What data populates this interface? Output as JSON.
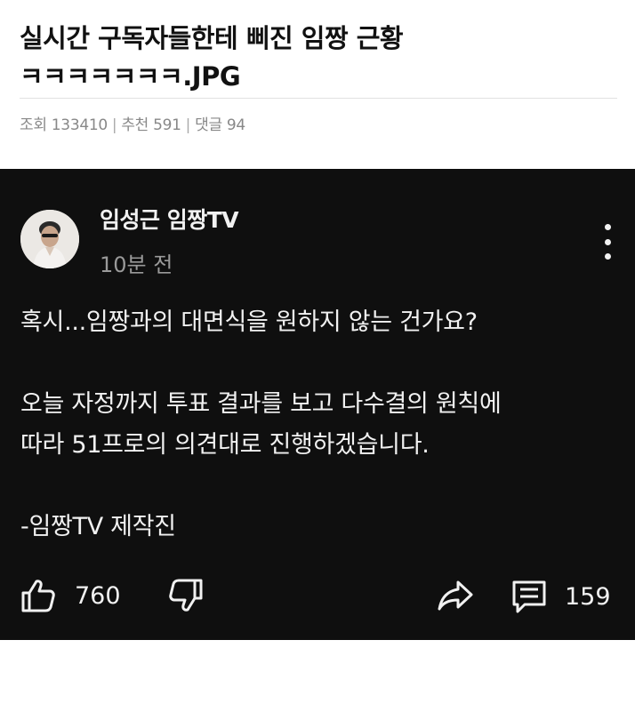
{
  "post": {
    "title_line1": "실시간 구독자들한테 삐진 임짱 근황",
    "title_line2": "ㅋㅋㅋㅋㅋㅋㅋ.JPG",
    "views_label": "조회 133410",
    "recommend_label": "추천 591",
    "comments_label": "댓글 94",
    "separator": "|"
  },
  "community_post": {
    "channel_name": "임성근 임짱TV",
    "time_ago": "10분 전",
    "body_line1": "혹시...임짱과의 대면식을 원하지 않는 건가요?",
    "body_line2": "오늘 자정까지 투표 결과를 보고 다수결의 원칙에",
    "body_line3": "따라 51프로의 의견대로 진행하겠습니다.",
    "body_line4": "-임짱TV 제작진",
    "likes": "760",
    "comments": "159"
  },
  "icons": {
    "like": "thumbs-up-icon",
    "dislike": "thumbs-down-icon",
    "share": "share-icon",
    "comment": "comment-icon",
    "more": "more-vertical-icon"
  },
  "colors": {
    "card_background": "#0f0f0f",
    "card_text": "#f1f1f1",
    "meta_text": "#888888"
  }
}
